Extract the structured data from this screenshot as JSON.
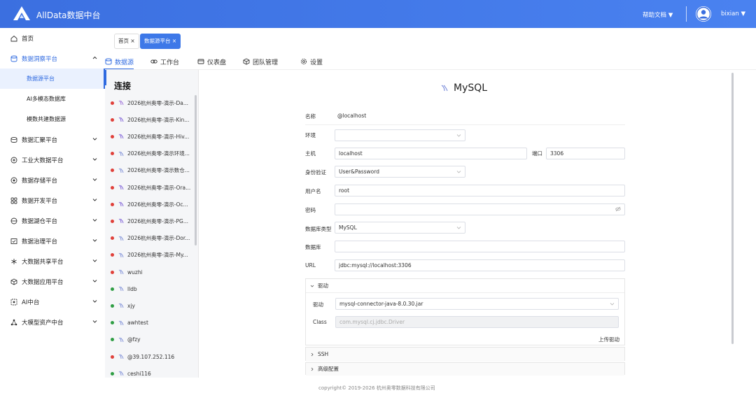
{
  "header": {
    "app_title": "AllData数据中台",
    "help_docs": "帮助文档 ▼",
    "username": "bixian ▼"
  },
  "sidebar": {
    "items": [
      {
        "label": "首页",
        "icon": "home-icon"
      },
      {
        "label": "数据洞察平台",
        "icon": "database-icon"
      },
      {
        "label": "数据源平台"
      },
      {
        "label": "AI多模态数据库"
      },
      {
        "label": "模数共建数据源"
      },
      {
        "label": "数据汇聚平台",
        "icon": "stack-icon"
      },
      {
        "label": "工业大数据平台",
        "icon": "factory-icon"
      },
      {
        "label": "数据存储平台",
        "icon": "storage-icon"
      },
      {
        "label": "数据开发平台",
        "icon": "dev-icon"
      },
      {
        "label": "数据湖仓平台",
        "icon": "lake-icon"
      },
      {
        "label": "数据治理平台",
        "icon": "governance-icon"
      },
      {
        "label": "大数据共享平台",
        "icon": "share-icon"
      },
      {
        "label": "大数据应用平台",
        "icon": "cube-icon"
      },
      {
        "label": "AI中台",
        "icon": "ai-icon"
      },
      {
        "label": "大模型资产中台",
        "icon": "model-icon"
      }
    ]
  },
  "page_tabs": [
    {
      "label": "首页 ×"
    },
    {
      "label": "数据源平台 ×"
    }
  ],
  "module_tabs": [
    {
      "label": "数据源"
    },
    {
      "label": "工作台"
    },
    {
      "label": "仪表盘"
    },
    {
      "label": "团队管理"
    },
    {
      "label": "设置"
    }
  ],
  "connections": {
    "title": "连接",
    "items": [
      {
        "label": "2026杭州奥零-演示-Da...",
        "status": "#e0403a",
        "icon": "#9a6bd6"
      },
      {
        "label": "2026杭州奥零-演示-Kin...",
        "status": "#e0403a",
        "icon": "#7b5cd6"
      },
      {
        "label": "2026杭州奥零-演示-Hiv...",
        "status": "#e0403a",
        "icon": "#7b5cd6"
      },
      {
        "label": "2026杭州奥零-演示环境...",
        "status": "#e0403a",
        "icon": "#7b8cd6"
      },
      {
        "label": "2026杭州奥零-演示数仓...",
        "status": "#e0403a",
        "icon": "#7b8cd6"
      },
      {
        "label": "2026杭州奥零-演示-Ora...",
        "status": "#e0403a",
        "icon": "#7b5cd6"
      },
      {
        "label": "2026杭州奥零-演示-Oc...",
        "status": "#e0403a",
        "icon": "#7b5cd6"
      },
      {
        "label": "2026杭州奥零-演示-PG...",
        "status": "#e0403a",
        "icon": "#7b5cd6"
      },
      {
        "label": "2026杭州奥零-演示-Dor...",
        "status": "#e0403a",
        "icon": "#7b8cd6"
      },
      {
        "label": "2026杭州奥零-演示-My...",
        "status": "#e0403a",
        "icon": "#7b8cd6"
      },
      {
        "label": "wuzhi",
        "status": "#e0403a",
        "icon": "#7b8cd6"
      },
      {
        "label": "lldb",
        "status": "#2f9e44",
        "icon": "#7b8cd6"
      },
      {
        "label": "xjy",
        "status": "#2f9e44",
        "icon": "#7b8cd6"
      },
      {
        "label": "awhtest",
        "status": "#2f9e44",
        "icon": "#7b8cd6"
      },
      {
        "label": "@fzy",
        "status": "#2f9e44",
        "icon": "#7b8cd6"
      },
      {
        "label": "@39.107.252.116",
        "status": "#e0403a",
        "icon": "#7b8cd6"
      },
      {
        "label": "ceshi116",
        "status": "#2f9e44",
        "icon": "#7b8cd6"
      }
    ]
  },
  "form": {
    "db_name": "MySQL",
    "name_label": "名称",
    "name_value": "@localhost",
    "env_label": "环境",
    "env_value": "",
    "host_label": "主机",
    "host_value": "localhost",
    "port_label": "端口",
    "port_value": "3306",
    "auth_label": "身份验证",
    "auth_value": "User&Password",
    "user_label": "用户名",
    "user_value": "root",
    "password_label": "密码",
    "password_value": "",
    "dbtype_label": "数据库类型",
    "dbtype_value": "MySQL",
    "database_label": "数据库",
    "database_value": "",
    "url_label": "URL",
    "url_value": "jdbc:mysql://localhost:3306",
    "driver_section": "驱动",
    "driver_label": "驱动",
    "driver_value": "mysql-connector-java-8.0.30.jar",
    "class_label": "Class",
    "class_value": "com.mysql.cj.jdbc.Driver",
    "upload_driver": "上传驱动",
    "ssh_section": "SSH",
    "advanced_section": "高级配置"
  },
  "footer": "copyright© 2019-2026 杭州奥零数据科技有限公司",
  "colors": {
    "primary": "#2f6ae0",
    "header_bg": "#3b6fe0",
    "status_red": "#e0403a",
    "status_green": "#2f9e44"
  }
}
